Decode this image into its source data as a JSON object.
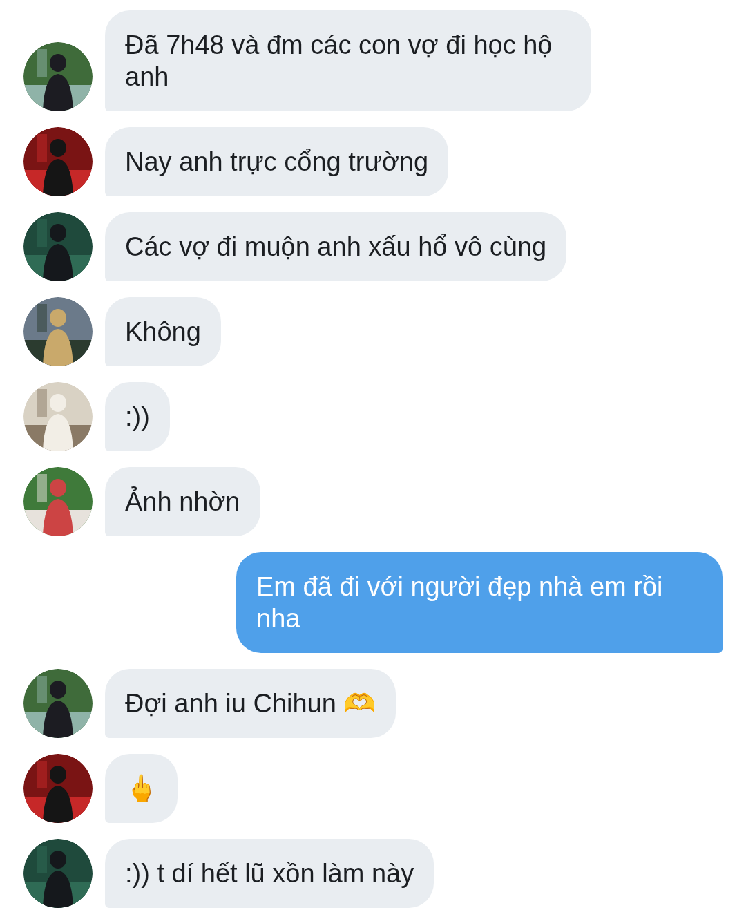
{
  "messages": [
    {
      "kind": "received",
      "text": "Đã 7h48 và đm các con vợ đi học hộ anh"
    },
    {
      "kind": "received",
      "text": "Nay anh trực cổng trường"
    },
    {
      "kind": "received",
      "text": "Các vợ đi muộn anh xấu hổ vô cùng"
    },
    {
      "kind": "received",
      "text": "Không"
    },
    {
      "kind": "received",
      "text": ":))"
    },
    {
      "kind": "received",
      "text": "Ảnh nhờn"
    },
    {
      "kind": "sent",
      "text": "Em đã đi với người đẹp nhà em rồi nha"
    },
    {
      "kind": "received",
      "text": "Đợi anh iu Chihun 🫶"
    },
    {
      "kind": "received",
      "text": "🖕"
    },
    {
      "kind": "received",
      "text": ":)) t dí hết lũ xồn làm này"
    }
  ]
}
